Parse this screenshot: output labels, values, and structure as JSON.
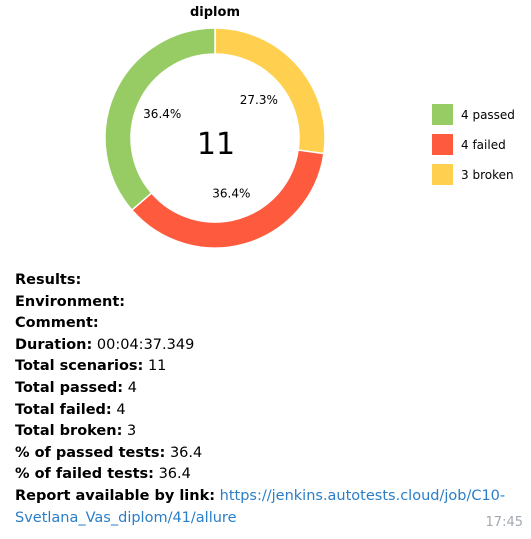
{
  "chart_data": {
    "type": "pie",
    "title": "diplom",
    "center_label": "11",
    "slices": [
      {
        "name": "4 passed",
        "value": 4,
        "percent_label": "36.4%",
        "color": "#97cc64"
      },
      {
        "name": "4 failed",
        "value": 4,
        "percent_label": "36.4%",
        "color": "#fd5a3e"
      },
      {
        "name": "3 broken",
        "value": 3,
        "percent_label": "27.3%",
        "color": "#ffd050"
      }
    ],
    "legend_placement": "right"
  },
  "report": {
    "results_label": "Results:",
    "environment_label": "Environment:",
    "comment_label": "Comment:",
    "duration_label": "Duration:",
    "duration_value": "00:04:37.349",
    "total_scenarios_label": "Total scenarios:",
    "total_scenarios_value": "11",
    "total_passed_label": "Total passed:",
    "total_passed_value": "4",
    "total_failed_label": "Total failed:",
    "total_failed_value": "4",
    "total_broken_label": "Total broken:",
    "total_broken_value": "3",
    "pct_passed_label": "% of passed tests:",
    "pct_passed_value": "36.4",
    "pct_failed_label": "% of failed tests:",
    "pct_failed_value": "36.4",
    "link_label": "Report available by link:",
    "link_text": "https://jenkins.autotests.cloud/job/C10-Svetlana_Vas_diplom/41/allure"
  },
  "message": {
    "time": "17:45"
  }
}
